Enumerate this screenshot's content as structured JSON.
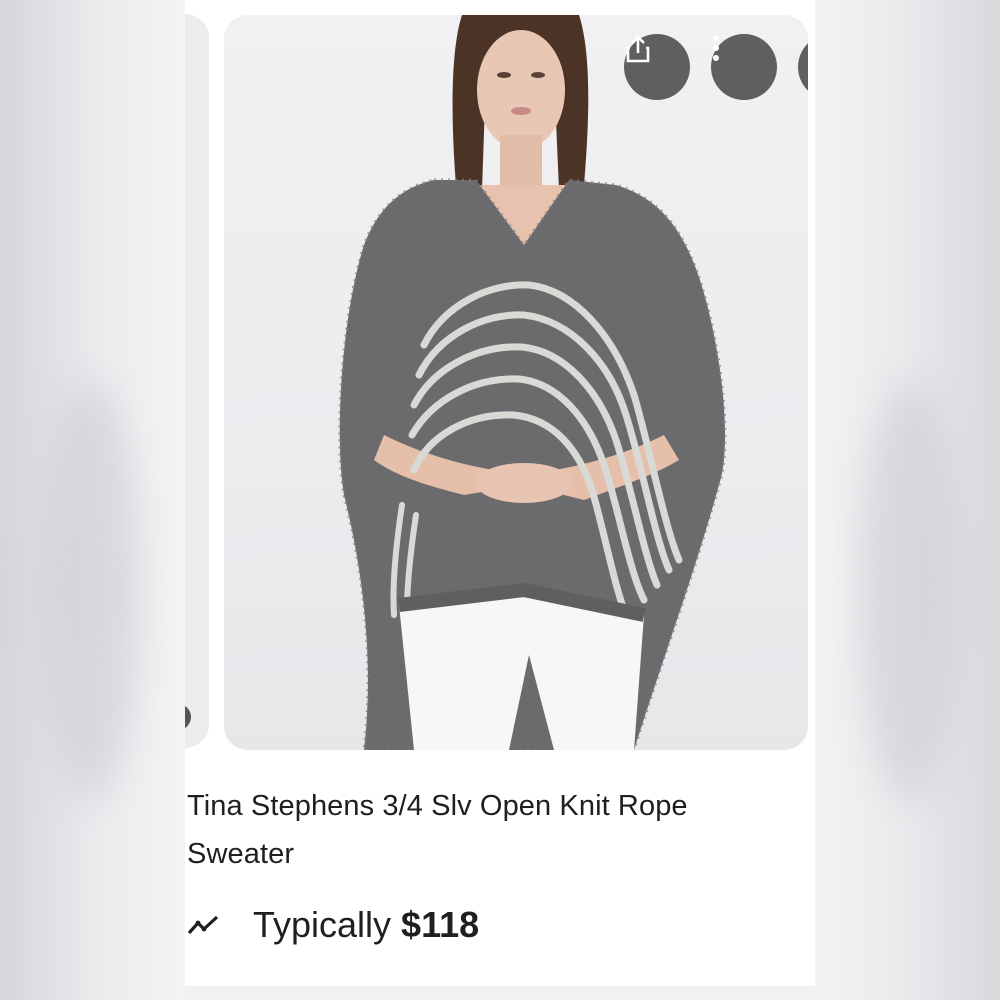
{
  "product": {
    "title": "Tina Stephens 3/4 Slv Open Knit Rope Sweater",
    "price_label": "Typically",
    "price_value": "$118"
  },
  "icons": {
    "share": "share-icon",
    "more": "more-vertical-icon",
    "trend": "price-trend-icon"
  },
  "colors": {
    "icon_button_bg": "#5f5f61",
    "sweater": "#6b6b6d",
    "rope": "#d9d9d6"
  }
}
